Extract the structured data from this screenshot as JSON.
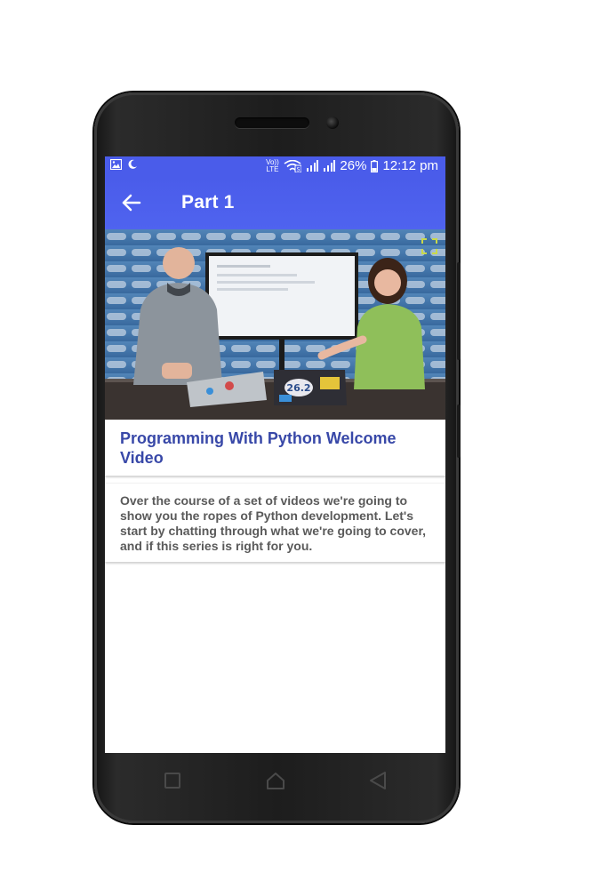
{
  "status_bar": {
    "volte_label": "Vo)) LTE",
    "battery_percent": "26%",
    "time": "12:12 pm",
    "icons": [
      "image-icon",
      "moon-icon",
      "volte-icon",
      "wifi-icon",
      "signal-icon",
      "signal-icon",
      "battery-icon"
    ]
  },
  "app_bar": {
    "title": "Part 1",
    "back_icon": "arrow-left-icon",
    "color": "#4a5cea"
  },
  "video": {
    "thumbnail_icon": "video-thumbnail",
    "fullscreen_icon": "fullscreen-icon",
    "laptop_sticker": "26.2"
  },
  "content": {
    "title": "Programming With Python Welcome Video",
    "description": "Over the course of a set of videos we're going to show you the ropes of Python development. Let's start by chatting through what we're going to cover, and if this series is right for you.",
    "title_color": "#3848a8",
    "description_color": "#5a5a5a"
  },
  "nav_bar": {
    "icons": [
      "recent-apps-icon",
      "home-icon",
      "back-icon"
    ]
  }
}
